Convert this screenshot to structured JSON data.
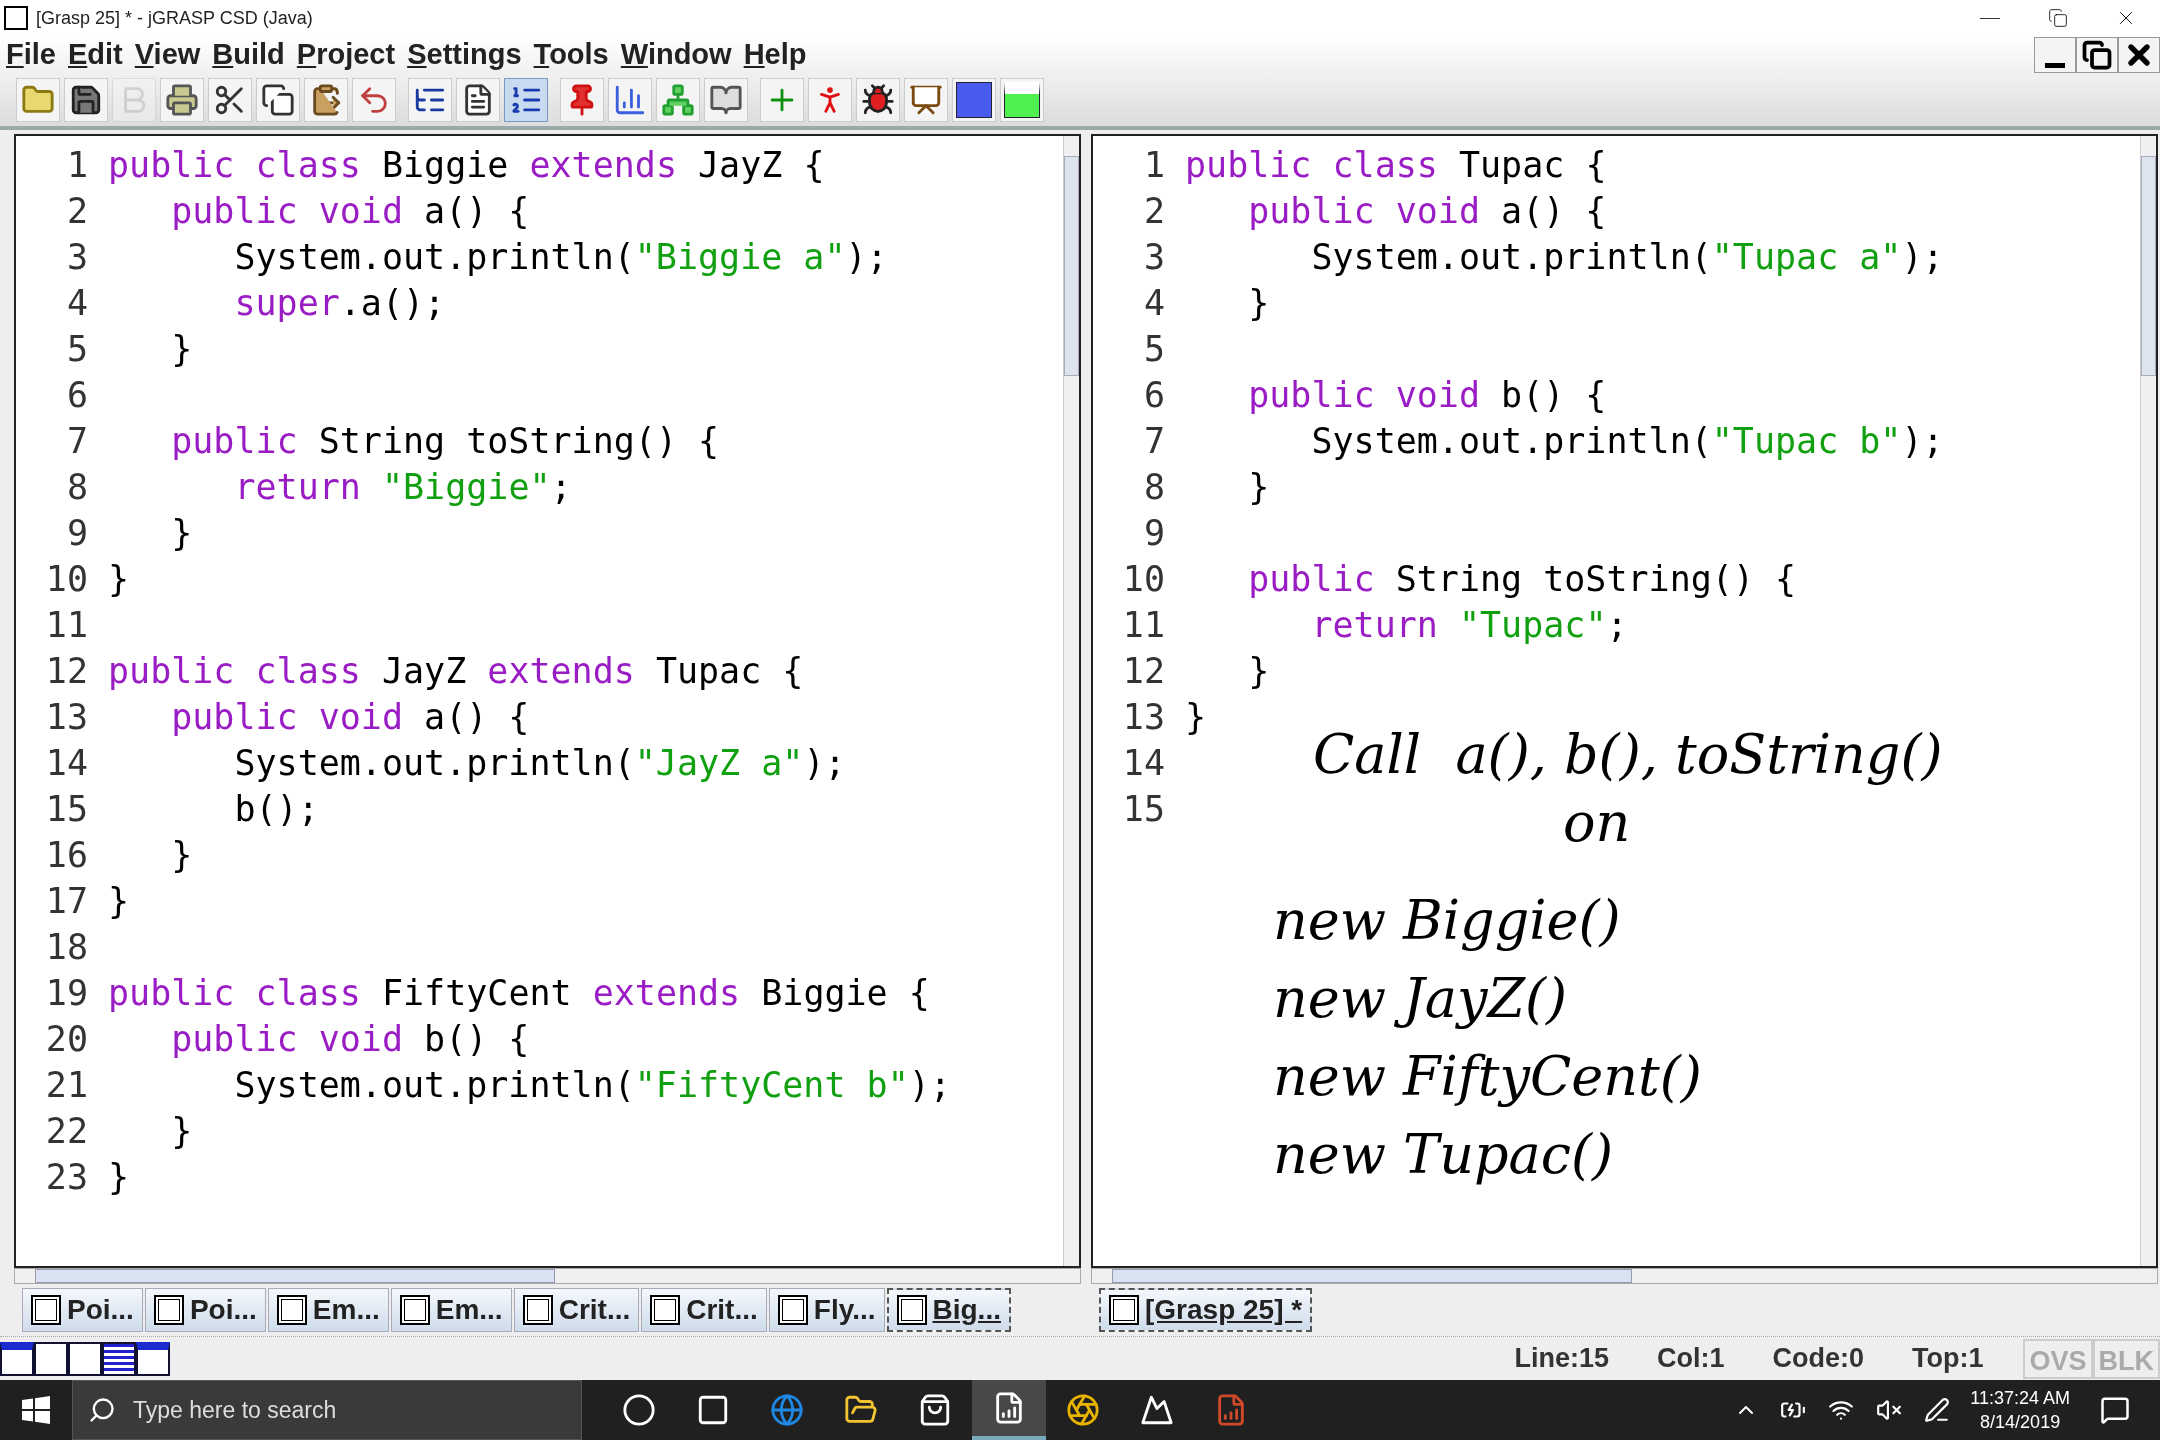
{
  "window": {
    "title": "[Grasp 25] * - jGRASP CSD (Java)"
  },
  "menu": [
    "File",
    "Edit",
    "View",
    "Build",
    "Project",
    "Settings",
    "Tools",
    "Window",
    "Help"
  ],
  "toolbar": [
    {
      "kind": "open",
      "on": false,
      "disabled": false
    },
    {
      "kind": "save",
      "on": false,
      "disabled": false
    },
    {
      "kind": "bold",
      "on": false,
      "disabled": true
    },
    {
      "kind": "print",
      "on": false,
      "disabled": false
    },
    {
      "kind": "cut",
      "on": false,
      "disabled": false
    },
    {
      "kind": "copy",
      "on": false,
      "disabled": false
    },
    {
      "kind": "paste",
      "on": false,
      "disabled": false
    },
    {
      "kind": "undo",
      "on": false,
      "disabled": false
    },
    {
      "kind": "csd",
      "on": false,
      "disabled": false
    },
    {
      "kind": "document",
      "on": false,
      "disabled": false
    },
    {
      "kind": "linenumbers",
      "on": true,
      "disabled": false
    },
    {
      "kind": "pin",
      "on": false,
      "disabled": false
    },
    {
      "kind": "chart",
      "on": false,
      "disabled": false
    },
    {
      "kind": "uml",
      "on": false,
      "disabled": false
    },
    {
      "kind": "book",
      "on": false,
      "disabled": false
    },
    {
      "kind": "compile",
      "on": false,
      "disabled": false
    },
    {
      "kind": "run",
      "on": false,
      "disabled": false
    },
    {
      "kind": "debug",
      "on": false,
      "disabled": false
    },
    {
      "kind": "animate",
      "on": false,
      "disabled": false
    },
    {
      "kind": "blue",
      "on": false,
      "disabled": false
    },
    {
      "kind": "green",
      "on": false,
      "disabled": false
    }
  ],
  "left_editor": {
    "lines": [
      {
        "n": "1",
        "tokens": [
          {
            "kind": "kw",
            "text": "public class"
          },
          {
            "kind": "plain",
            "text": " Biggie "
          },
          {
            "kind": "kw",
            "text": "extends"
          },
          {
            "kind": "plain",
            "text": " JayZ {"
          }
        ]
      },
      {
        "n": "2",
        "tokens": [
          {
            "kind": "kw",
            "text": "   public void"
          },
          {
            "kind": "plain",
            "text": " a() {"
          }
        ]
      },
      {
        "n": "3",
        "tokens": [
          {
            "kind": "plain",
            "text": "      System.out.println("
          },
          {
            "kind": "str",
            "text": "\"Biggie a\""
          },
          {
            "kind": "plain",
            "text": ");"
          }
        ]
      },
      {
        "n": "4",
        "tokens": [
          {
            "kind": "kw",
            "text": "      super"
          },
          {
            "kind": "plain",
            "text": ".a();"
          }
        ]
      },
      {
        "n": "5",
        "tokens": [
          {
            "kind": "plain",
            "text": "   }"
          }
        ]
      },
      {
        "n": "6"
      },
      {
        "n": "7",
        "tokens": [
          {
            "kind": "kw",
            "text": "   public"
          },
          {
            "kind": "plain",
            "text": " String toString() {"
          }
        ]
      },
      {
        "n": "8",
        "tokens": [
          {
            "kind": "kw",
            "text": "      return"
          },
          {
            "kind": "str",
            "text": " \"Biggie\""
          },
          {
            "kind": "plain",
            "text": ";"
          }
        ]
      },
      {
        "n": "9",
        "tokens": [
          {
            "kind": "plain",
            "text": "   }"
          }
        ]
      },
      {
        "n": "10",
        "tokens": [
          {
            "kind": "plain",
            "text": "}"
          }
        ]
      },
      {
        "n": "11"
      },
      {
        "n": "12",
        "tokens": [
          {
            "kind": "kw",
            "text": "public class"
          },
          {
            "kind": "plain",
            "text": " JayZ "
          },
          {
            "kind": "kw",
            "text": "extends"
          },
          {
            "kind": "plain",
            "text": " Tupac {"
          }
        ]
      },
      {
        "n": "13",
        "tokens": [
          {
            "kind": "kw",
            "text": "   public void"
          },
          {
            "kind": "plain",
            "text": " a() {"
          }
        ]
      },
      {
        "n": "14",
        "tokens": [
          {
            "kind": "plain",
            "text": "      System.out.println("
          },
          {
            "kind": "str",
            "text": "\"JayZ a\""
          },
          {
            "kind": "plain",
            "text": ");"
          }
        ]
      },
      {
        "n": "15",
        "tokens": [
          {
            "kind": "plain",
            "text": "      b();"
          }
        ]
      },
      {
        "n": "16",
        "tokens": [
          {
            "kind": "plain",
            "text": "   }"
          }
        ]
      },
      {
        "n": "17",
        "tokens": [
          {
            "kind": "plain",
            "text": "}"
          }
        ]
      },
      {
        "n": "18"
      },
      {
        "n": "19",
        "tokens": [
          {
            "kind": "kw",
            "text": "public class"
          },
          {
            "kind": "plain",
            "text": " FiftyCent "
          },
          {
            "kind": "kw",
            "text": "extends"
          },
          {
            "kind": "plain",
            "text": " Biggie {"
          }
        ]
      },
      {
        "n": "20",
        "tokens": [
          {
            "kind": "kw",
            "text": "   public void"
          },
          {
            "kind": "plain",
            "text": " b() {"
          }
        ]
      },
      {
        "n": "21",
        "tokens": [
          {
            "kind": "plain",
            "text": "      System.out.println("
          },
          {
            "kind": "str",
            "text": "\"FiftyCent b\""
          },
          {
            "kind": "plain",
            "text": ");"
          }
        ]
      },
      {
        "n": "22",
        "tokens": [
          {
            "kind": "plain",
            "text": "   }"
          }
        ]
      },
      {
        "n": "23",
        "tokens": [
          {
            "kind": "plain",
            "text": "}"
          }
        ]
      }
    ],
    "tabs": [
      {
        "label": "Poi...",
        "selected": false
      },
      {
        "label": "Poi...",
        "selected": false
      },
      {
        "label": "Em...",
        "selected": false
      },
      {
        "label": "Em...",
        "selected": false
      },
      {
        "label": "Crit...",
        "selected": false
      },
      {
        "label": "Crit...",
        "selected": false
      },
      {
        "label": "Fly...",
        "selected": false
      },
      {
        "label": "Big...",
        "selected": true
      }
    ]
  },
  "right_editor": {
    "lines": [
      {
        "n": "1",
        "tokens": [
          {
            "kind": "kw",
            "text": "public class"
          },
          {
            "kind": "plain",
            "text": " Tupac {"
          }
        ]
      },
      {
        "n": "2",
        "tokens": [
          {
            "kind": "kw",
            "text": "   public void"
          },
          {
            "kind": "plain",
            "text": " a() {"
          }
        ]
      },
      {
        "n": "3",
        "tokens": [
          {
            "kind": "plain",
            "text": "      System.out.println("
          },
          {
            "kind": "str",
            "text": "\"Tupac a\""
          },
          {
            "kind": "plain",
            "text": ");"
          }
        ]
      },
      {
        "n": "4",
        "tokens": [
          {
            "kind": "plain",
            "text": "   }"
          }
        ]
      },
      {
        "n": "5"
      },
      {
        "n": "6",
        "tokens": [
          {
            "kind": "kw",
            "text": "   public void"
          },
          {
            "kind": "plain",
            "text": " b() {"
          }
        ]
      },
      {
        "n": "7",
        "tokens": [
          {
            "kind": "plain",
            "text": "      System.out.println("
          },
          {
            "kind": "str",
            "text": "\"Tupac b\""
          },
          {
            "kind": "plain",
            "text": ");"
          }
        ]
      },
      {
        "n": "8",
        "tokens": [
          {
            "kind": "plain",
            "text": "   }"
          }
        ]
      },
      {
        "n": "9"
      },
      {
        "n": "10",
        "tokens": [
          {
            "kind": "kw",
            "text": "   public"
          },
          {
            "kind": "plain",
            "text": " String toString() {"
          }
        ]
      },
      {
        "n": "11",
        "tokens": [
          {
            "kind": "kw",
            "text": "      return"
          },
          {
            "kind": "str",
            "text": " \"Tupac\""
          },
          {
            "kind": "plain",
            "text": ";"
          }
        ]
      },
      {
        "n": "12",
        "tokens": [
          {
            "kind": "plain",
            "text": "   }"
          }
        ]
      },
      {
        "n": "13",
        "tokens": [
          {
            "kind": "plain",
            "text": "}"
          }
        ]
      },
      {
        "n": "14"
      },
      {
        "n": "15"
      }
    ],
    "handwritten_notes": [
      "Call  a(), b(), toString()",
      "on",
      "new Biggie()",
      "new JayZ()",
      "new FiftyCent()",
      "new Tupac()"
    ],
    "tabs": [
      {
        "label": "[Grasp 25] *",
        "selected": true
      }
    ]
  },
  "status_bar": {
    "fields": [
      "Line:15",
      "Col:1",
      "Code:0",
      "Top:1"
    ],
    "indicators": [
      {
        "label": "OVS",
        "on": false
      },
      {
        "label": "BLK",
        "on": false
      }
    ]
  },
  "taskbar": {
    "search": {
      "placeholder": "Type here to search"
    },
    "apps": [
      {
        "kind": "cortana",
        "selected": false
      },
      {
        "kind": "taskview",
        "selected": false
      },
      {
        "kind": "edge",
        "selected": false
      },
      {
        "kind": "explorer",
        "selected": false
      },
      {
        "kind": "store",
        "selected": false
      },
      {
        "kind": "jgrasp",
        "selected": true
      },
      {
        "kind": "chrome",
        "selected": false
      },
      {
        "kind": "photos",
        "selected": false
      },
      {
        "kind": "powerpoint",
        "selected": false
      }
    ],
    "time": "11:37:24 AM",
    "date": "8/14/2019"
  }
}
